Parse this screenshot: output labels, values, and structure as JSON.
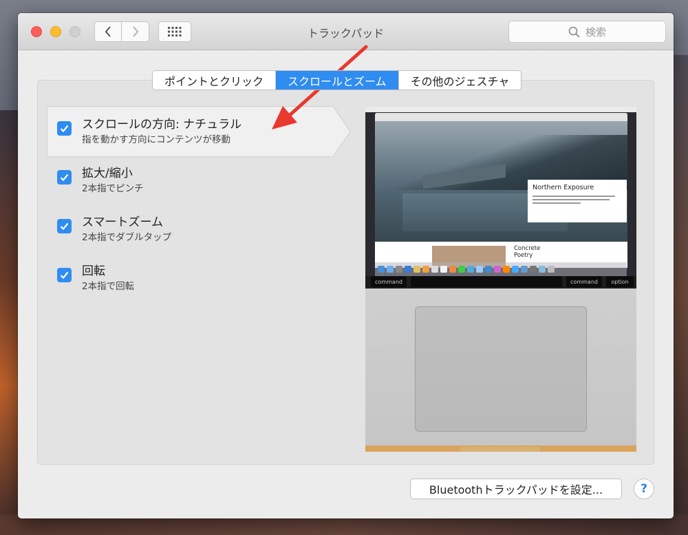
{
  "window": {
    "title": "トラックパッド"
  },
  "toolbar": {
    "search_placeholder": "検索"
  },
  "tabs": [
    {
      "label": "ポイントとクリック",
      "active": false
    },
    {
      "label": "スクロールとズーム",
      "active": true
    },
    {
      "label": "その他のジェスチャ",
      "active": false
    }
  ],
  "options": [
    {
      "label": "スクロールの方向: ナチュラル",
      "sub": "指を動かす方向にコンテンツが移動",
      "checked": true,
      "selected": true
    },
    {
      "label": "拡大/縮小",
      "sub": "2本指でピンチ",
      "checked": true,
      "selected": false
    },
    {
      "label": "スマートズーム",
      "sub": "2本指でダブルタップ",
      "checked": true,
      "selected": false
    },
    {
      "label": "回転",
      "sub": "2本指で回転",
      "checked": true,
      "selected": false
    }
  ],
  "preview": {
    "card_title": "Northern Exposure",
    "card2_title": "Concrete\nPoetry",
    "keys": {
      "command_left": "command",
      "command_right": "command",
      "option": "option"
    }
  },
  "footer": {
    "bluetooth_button": "Bluetoothトラックパッドを設定...",
    "help_button": "?"
  },
  "colors": {
    "accent": "#2f8cf0",
    "arrow": "#e8382f"
  }
}
